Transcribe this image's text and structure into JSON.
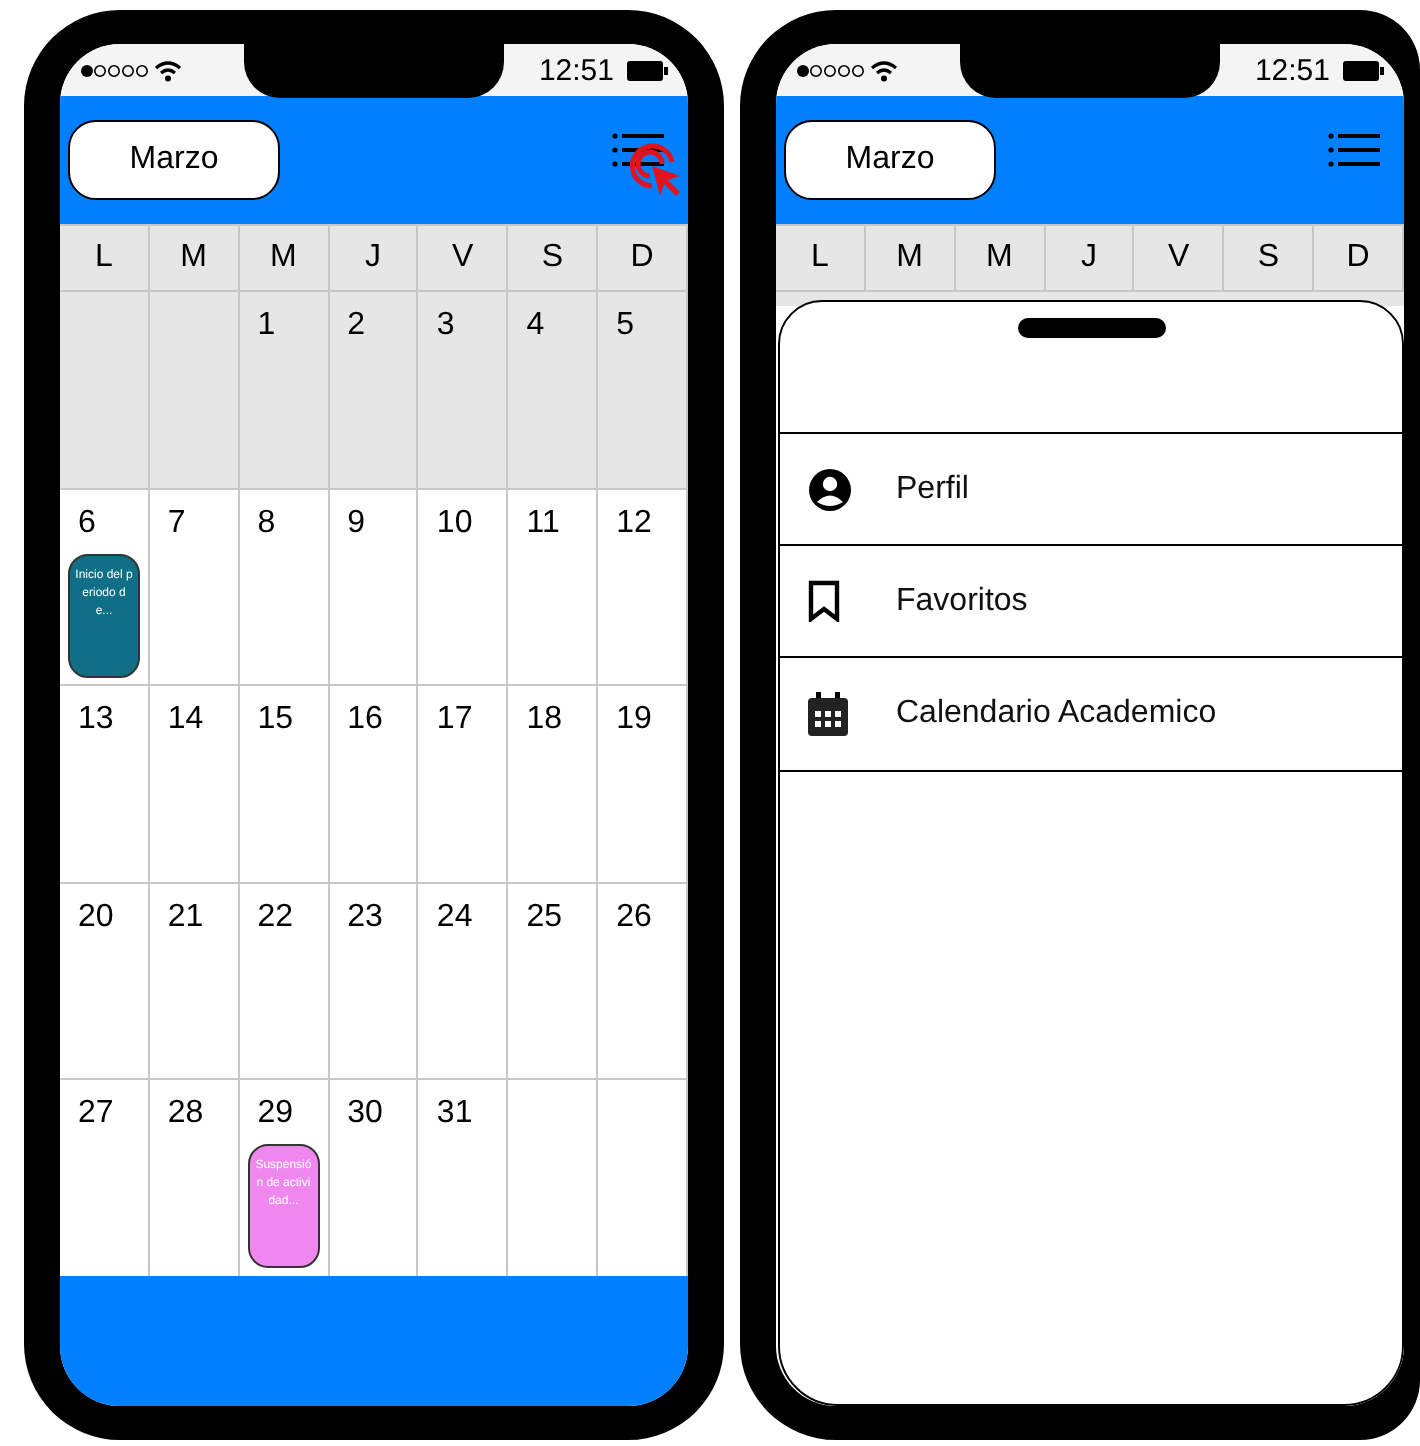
{
  "phones": [
    {
      "kind": "calendar",
      "status_bar": {
        "time": "12:51"
      },
      "header": {
        "month_button": "Marzo",
        "menu_clicked": true
      },
      "weekdays": [
        "L",
        "M",
        "M",
        "J",
        "V",
        "S",
        "D"
      ],
      "weeks": [
        {
          "kind": "partial_start",
          "shaded": true,
          "days": [
            {
              "day": "1"
            },
            {
              "day": "2"
            },
            {
              "day": "3"
            },
            {
              "day": "4"
            },
            {
              "day": "5"
            }
          ]
        },
        {
          "shaded": false,
          "days": [
            {
              "day": "6",
              "event": {
                "text": "Inicio del periodo de...",
                "color": "#0e6f86"
              }
            },
            {
              "day": "7"
            },
            {
              "day": "8"
            },
            {
              "day": "9"
            },
            {
              "day": "10"
            },
            {
              "day": "11"
            },
            {
              "day": "12"
            }
          ]
        },
        {
          "shaded": false,
          "days": [
            {
              "day": "13"
            },
            {
              "day": "14"
            },
            {
              "day": "15"
            },
            {
              "day": "16"
            },
            {
              "day": "17"
            },
            {
              "day": "18"
            },
            {
              "day": "19"
            }
          ]
        },
        {
          "shaded": false,
          "days": [
            {
              "day": "20"
            },
            {
              "day": "21"
            },
            {
              "day": "22"
            },
            {
              "day": "23"
            },
            {
              "day": "24"
            },
            {
              "day": "25"
            },
            {
              "day": "26"
            }
          ]
        },
        {
          "kind": "partial_end",
          "shaded": false,
          "days": [
            {
              "day": "27"
            },
            {
              "day": "28"
            },
            {
              "day": "29",
              "event": {
                "text": "Suspensión de actividad...",
                "color": "#ee88ee"
              }
            },
            {
              "day": "30"
            },
            {
              "day": "31"
            }
          ]
        }
      ]
    },
    {
      "kind": "menu",
      "status_bar": {
        "time": "12:51"
      },
      "header": {
        "month_button": "Marzo",
        "menu_clicked": false
      },
      "weekdays": [
        "L",
        "M",
        "M",
        "J",
        "V",
        "S",
        "D"
      ],
      "sheet": {
        "items": [
          {
            "kind": "profile",
            "label": "Perfil"
          },
          {
            "kind": "bookmark",
            "label": "Favoritos"
          },
          {
            "kind": "calendar",
            "label": "Calendario Academico"
          }
        ]
      }
    }
  ]
}
